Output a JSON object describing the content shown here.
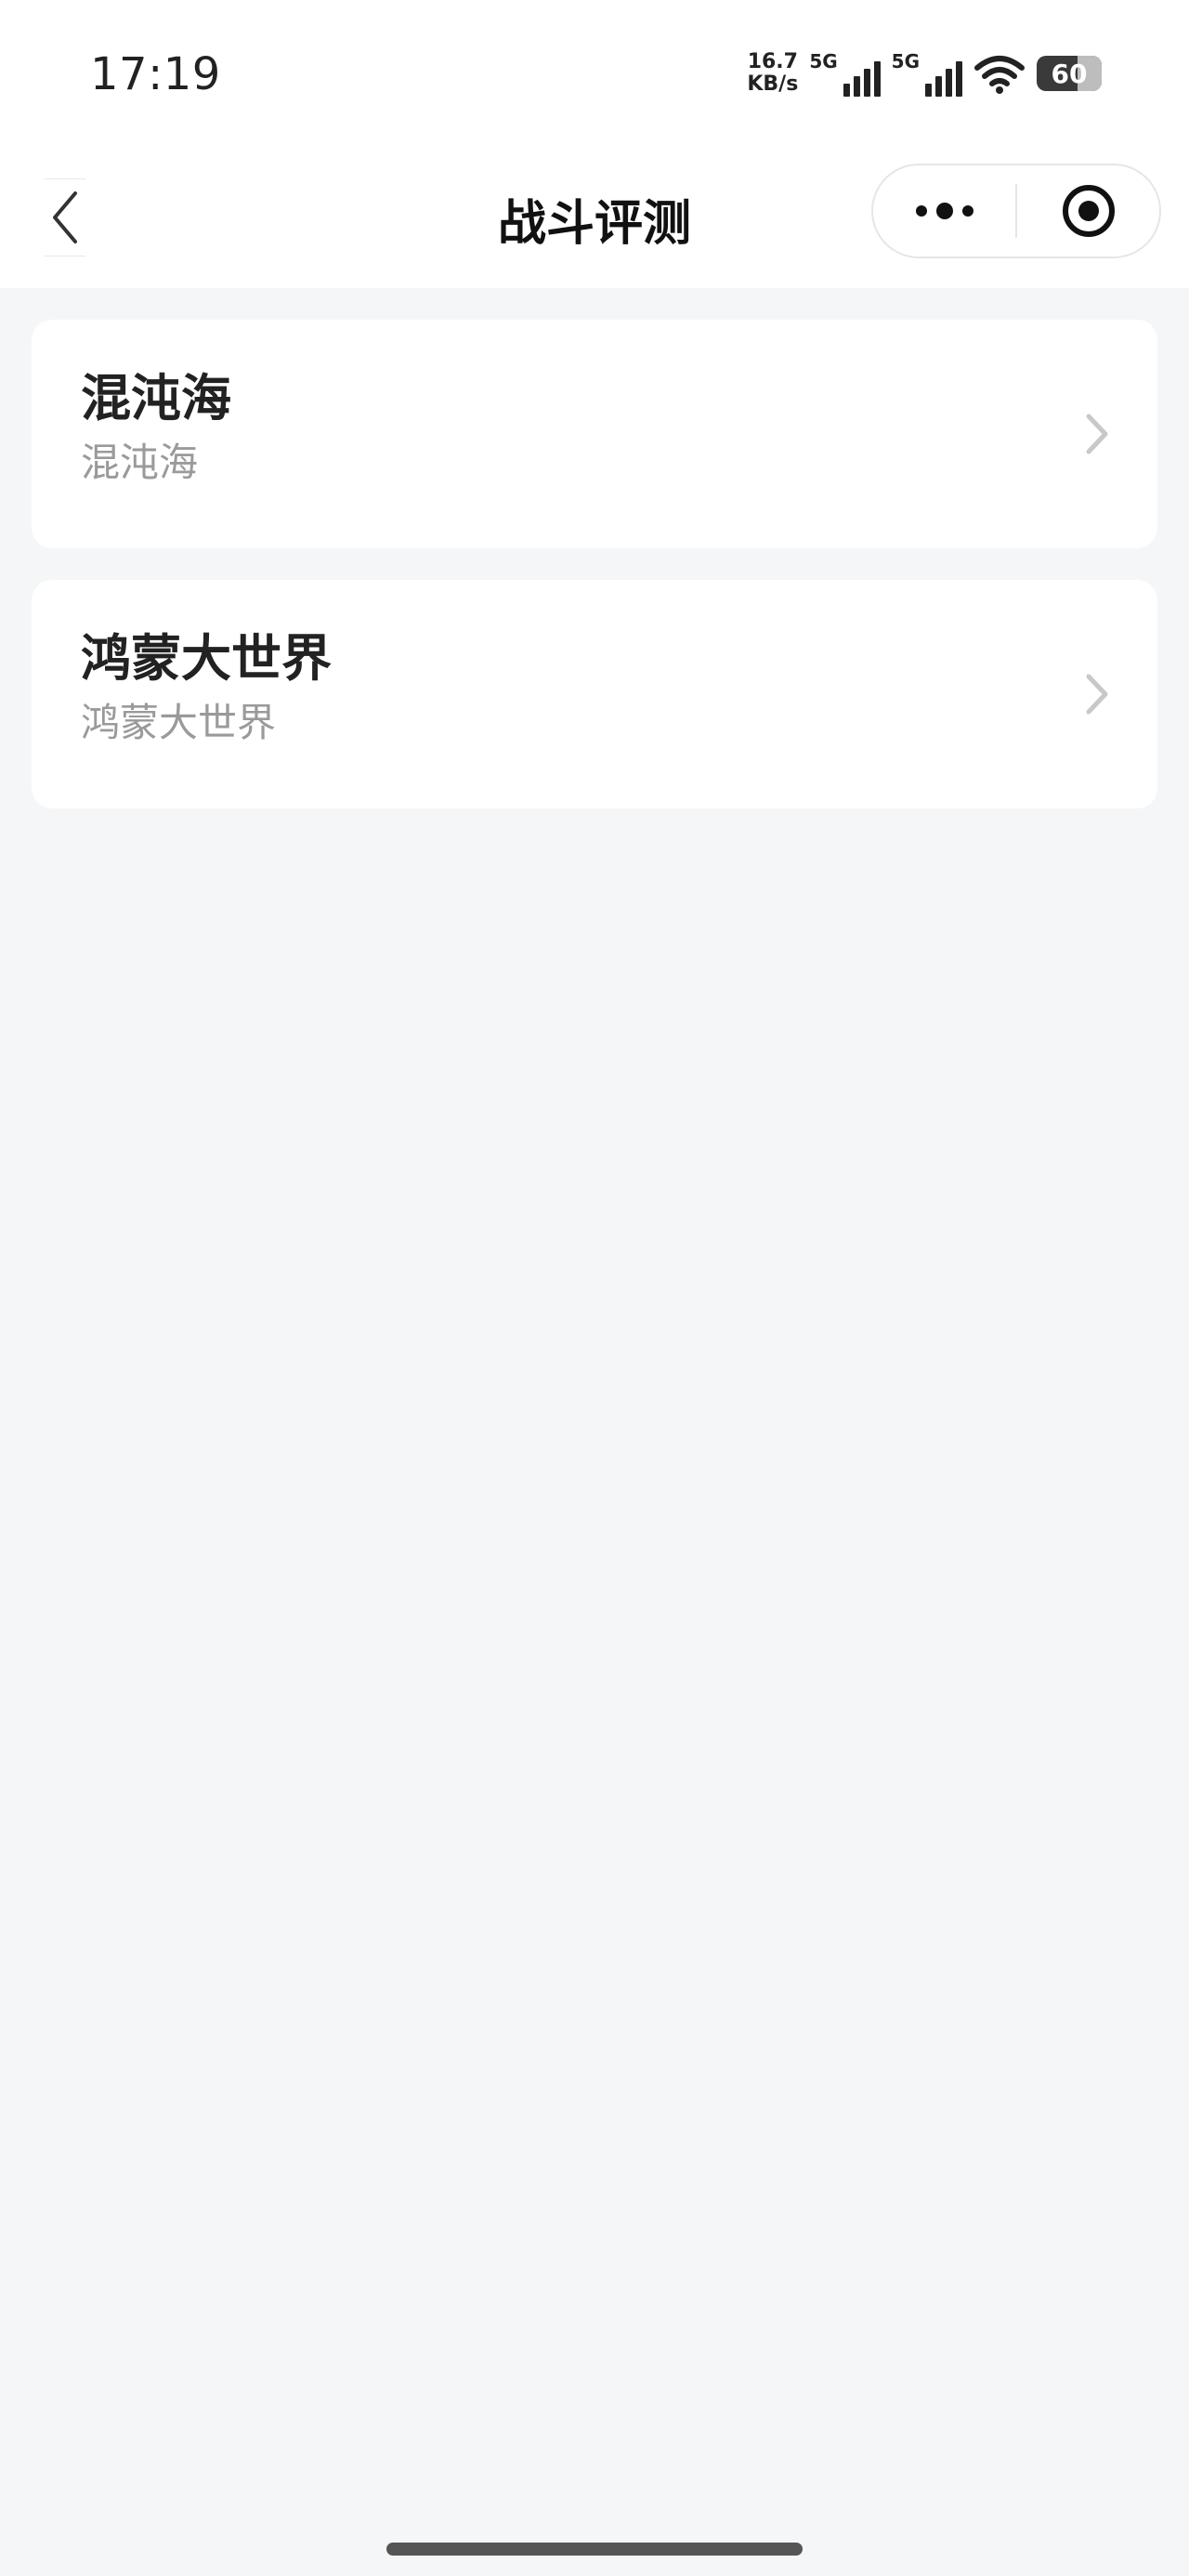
{
  "status_bar": {
    "time": "17:19",
    "net_speed_value": "16.7",
    "net_speed_unit": "KB/s",
    "signal1_label": "5G",
    "signal2_label": "5G",
    "battery_level": "60"
  },
  "navbar": {
    "title": "战斗评测"
  },
  "list": {
    "items": [
      {
        "title": "混沌海",
        "subtitle": "混沌海"
      },
      {
        "title": "鸿蒙大世界",
        "subtitle": "鸿蒙大世界"
      }
    ]
  },
  "colors": {
    "page_background": "#f5f6f8",
    "card_background": "#ffffff",
    "subtitle_text": "#9a9a9a",
    "chevron": "#c8c8c8"
  }
}
